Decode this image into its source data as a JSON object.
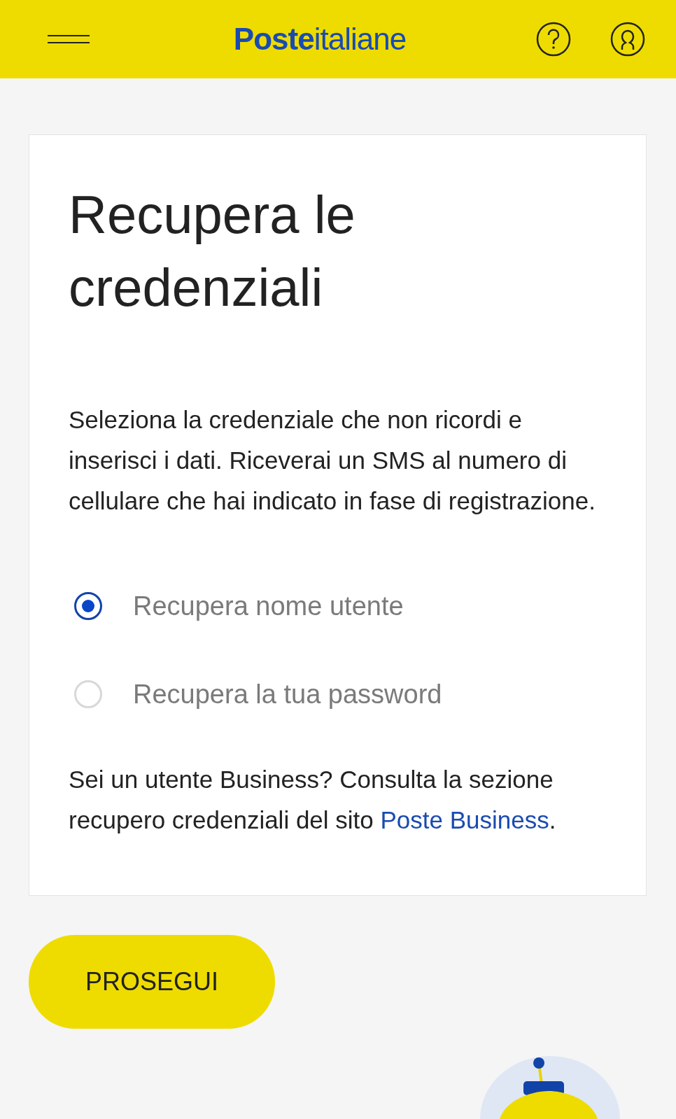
{
  "header": {
    "logo": "**Poste**italiane"
  },
  "card": {
    "title": "Recupera le credenziali",
    "intro": "Seleziona la credenziale che non ricordi e inserisci i dati. Riceverai un SMS al numero di cellulare che hai indicato in fase di registrazione.",
    "options": [
      {
        "label": "Recupera nome utente",
        "selected": true
      },
      {
        "label": "Recupera la tua password",
        "selected": false
      }
    ],
    "business_note": {
      "text": "Sei un utente Business? Consulta la sezione recupero credenziali del sito",
      "link": "Poste Business",
      "suffix": "."
    }
  },
  "buttons": [
    "PROSEGUI"
  ]
}
